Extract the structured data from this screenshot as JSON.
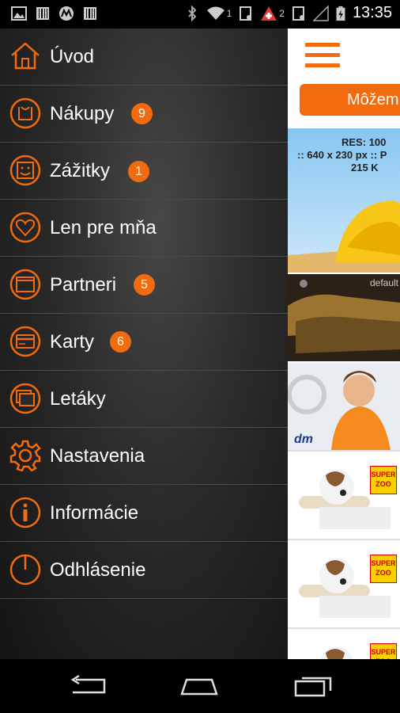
{
  "status_bar": {
    "sim1": "1",
    "sim2": "2",
    "time": "13:35"
  },
  "drawer": {
    "items": [
      {
        "label": "Úvod",
        "icon": "home-icon"
      },
      {
        "label": "Nákupy",
        "icon": "shopping-bag-icon",
        "badge": "9"
      },
      {
        "label": "Zážitky",
        "icon": "smiley-icon",
        "badge": "1"
      },
      {
        "label": "Len pre mňa",
        "icon": "heart-icon"
      },
      {
        "label": "Partneri",
        "icon": "window-icon",
        "badge": "5"
      },
      {
        "label": "Karty",
        "icon": "card-icon",
        "badge": "6"
      },
      {
        "label": "Letáky",
        "icon": "leaflets-icon"
      },
      {
        "label": "Nastavenia",
        "icon": "gear-icon"
      },
      {
        "label": "Informácie",
        "icon": "info-icon"
      },
      {
        "label": "Odhlásenie",
        "icon": "power-icon"
      }
    ]
  },
  "content": {
    "orange_button": "Môžem",
    "banner_text": "RES: 100",
    "banner_text2": ":: 640 x 230 px :: P",
    "banner_text3": "215 K",
    "tile2_label": "default",
    "tile3_logo": "dm",
    "zoo_logo": "SUPER ZOO"
  },
  "colors": {
    "accent": "#f26b0f",
    "drawer_bg": "#2b2b2b",
    "divider": "#4a4a4a"
  }
}
